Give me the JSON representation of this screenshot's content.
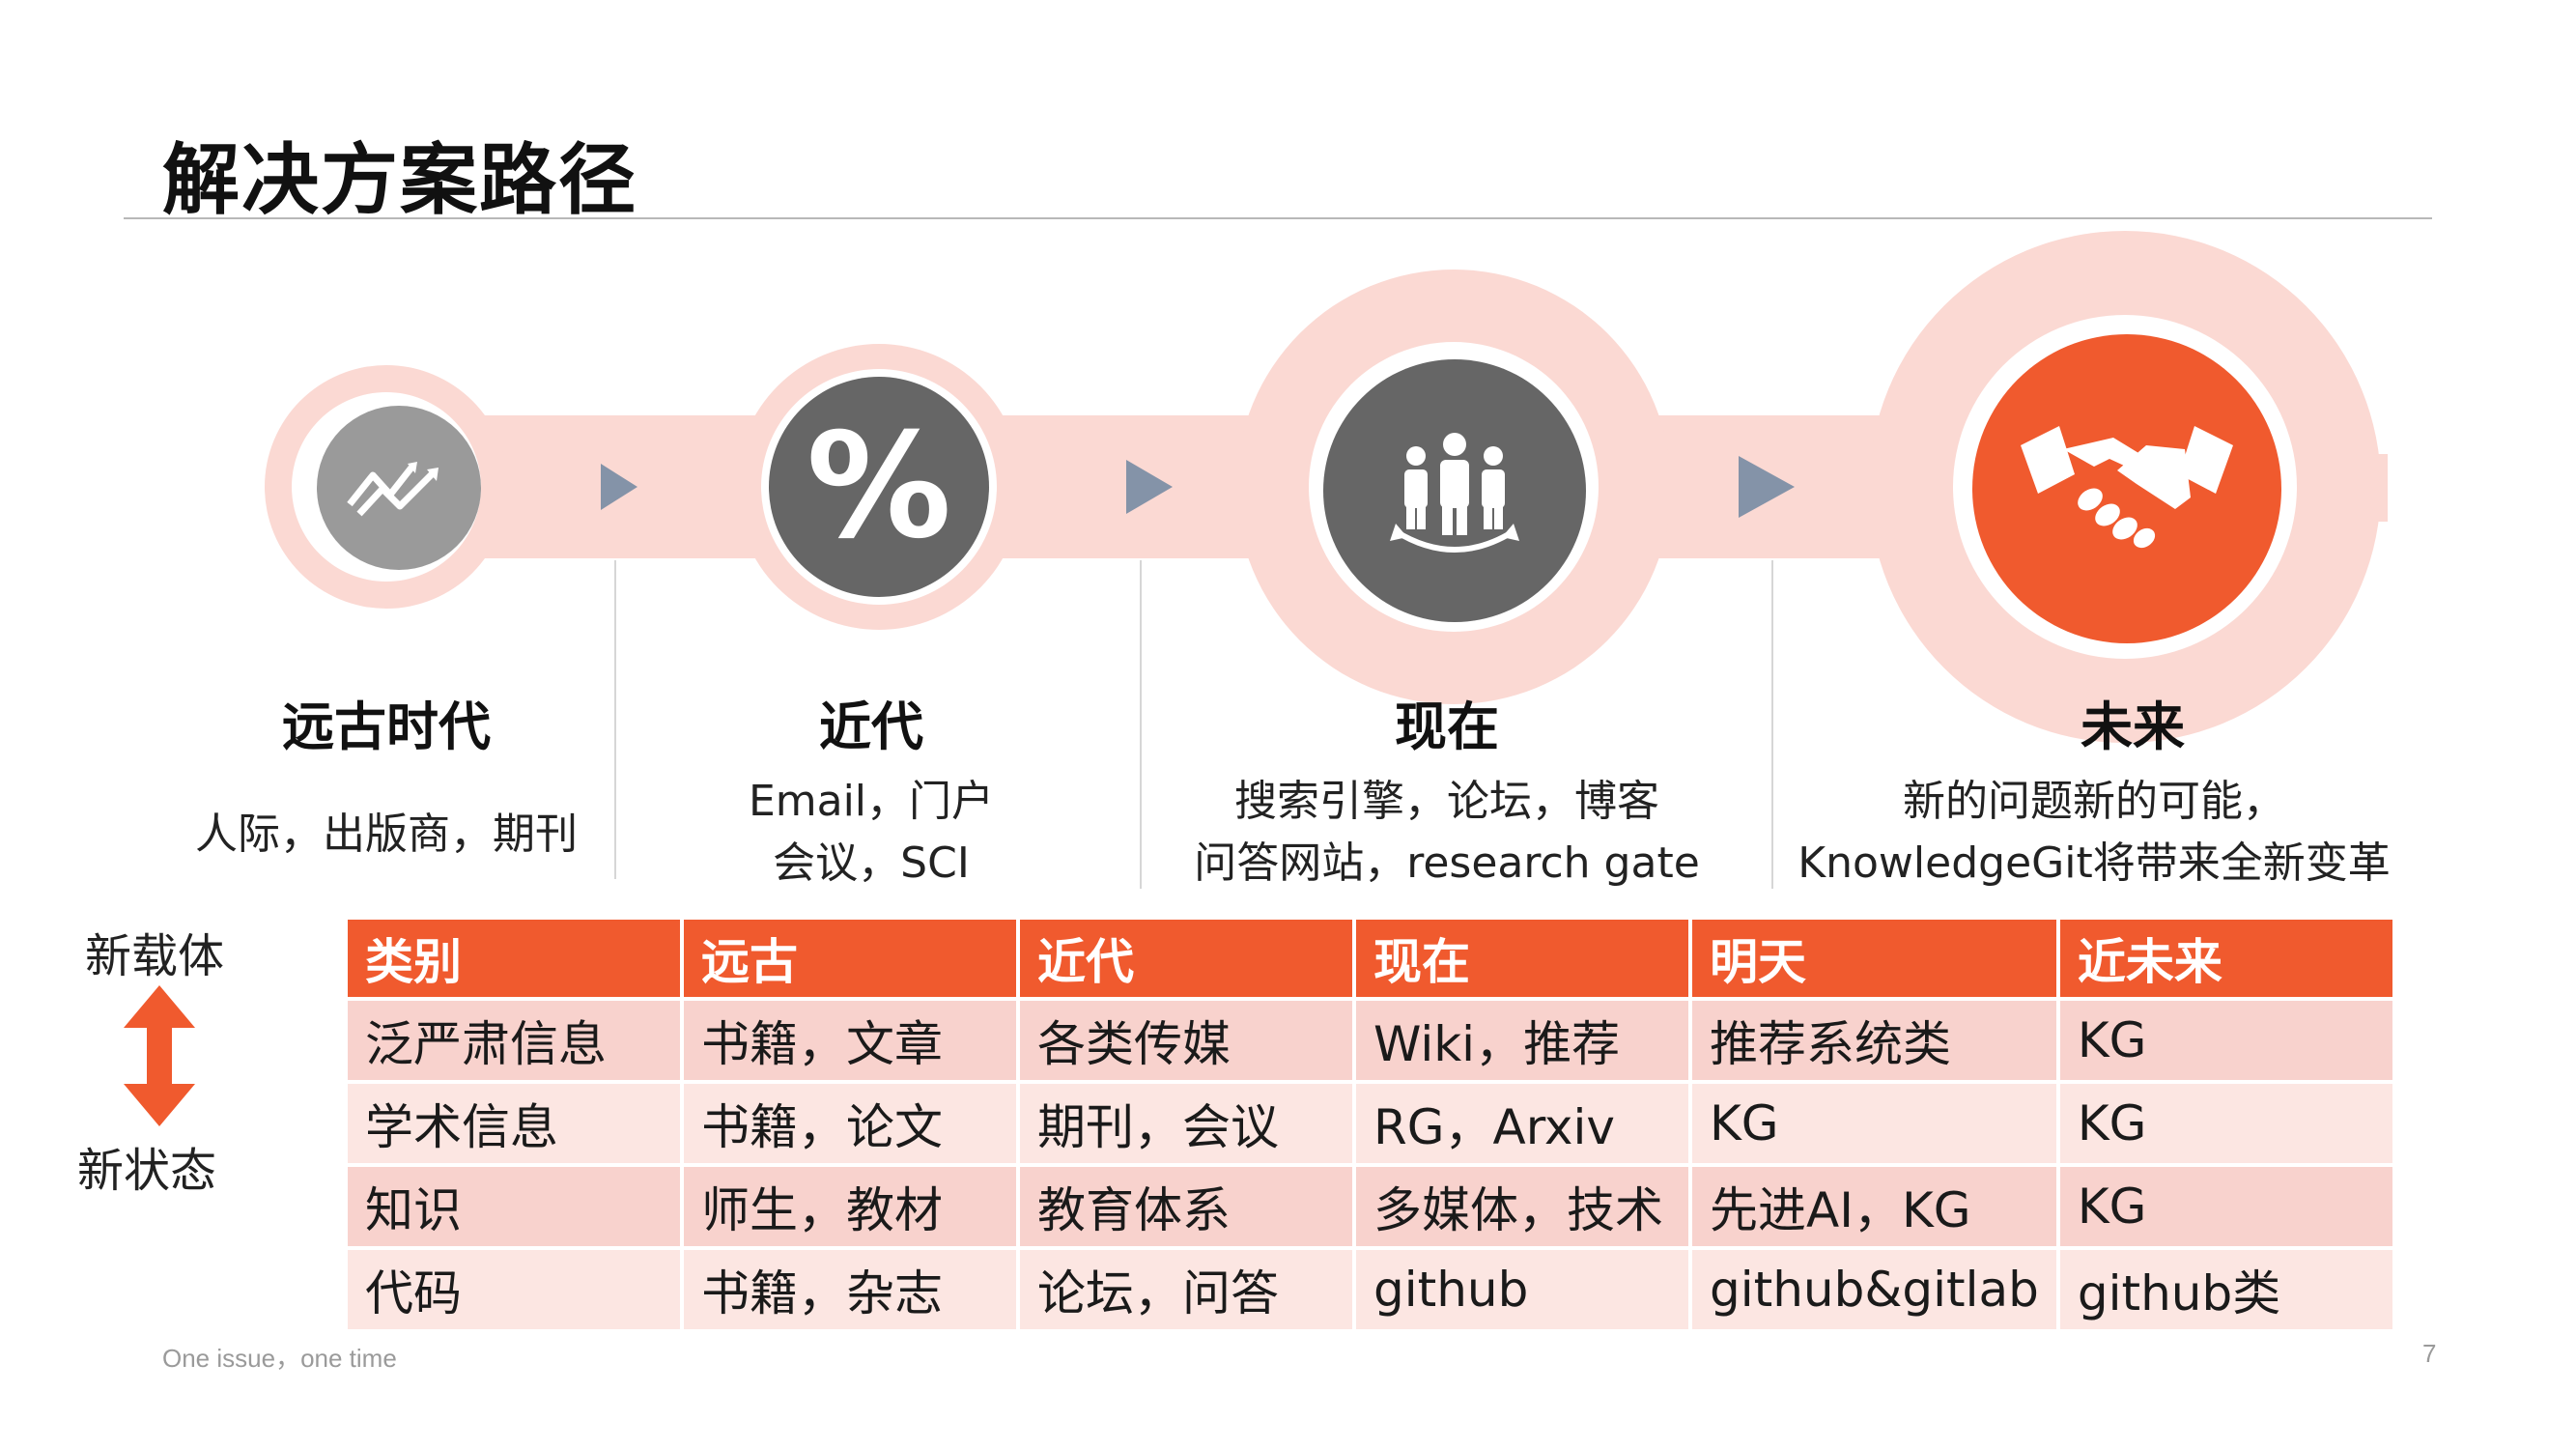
{
  "title": "解决方案路径",
  "eras": [
    {
      "title": "远古时代",
      "desc_lines": [
        "人际，出版商，期刊"
      ],
      "icon": "trend-icon"
    },
    {
      "title": "近代",
      "desc_lines": [
        "Email，门户",
        "会议，SCI"
      ],
      "icon": "percent-icon"
    },
    {
      "title": "现在",
      "desc_lines": [
        "搜索引擎，论坛，博客",
        "问答网站，research gate"
      ],
      "icon": "team-icon"
    },
    {
      "title": "未来",
      "desc_lines": [
        "新的问题新的可能，",
        "KnowledgeGit将带来全新变革"
      ],
      "icon": "handshake-icon"
    }
  ],
  "percent_glyph": "%",
  "side": {
    "top": "新载体",
    "bottom": "新状态"
  },
  "table": {
    "headers": [
      "类别",
      "远古",
      "近代",
      "现在",
      "明天",
      "近未来"
    ],
    "rows": [
      [
        "泛严肃信息",
        "书籍，文章",
        "各类传媒",
        "Wiki，推荐",
        "推荐系统类",
        "KG"
      ],
      [
        "学术信息",
        "书籍，论文",
        "期刊，会议",
        "RG，Arxiv",
        "KG",
        "KG"
      ],
      [
        "知识",
        "师生，教材",
        "教育体系",
        "多媒体，技术",
        "先进AI，KG",
        "KG"
      ],
      [
        "代码",
        "书籍，杂志",
        "论坛，问答",
        "github",
        "github&gitlab",
        "github类"
      ]
    ]
  },
  "footer": {
    "left": "One issue，one time",
    "page": "7"
  },
  "colors": {
    "accent": "#f05a2e",
    "blob": "#fbd9d3",
    "dark_circle": "#666666",
    "light_circle": "#9a9a9a",
    "arrow": "#8493a8"
  }
}
